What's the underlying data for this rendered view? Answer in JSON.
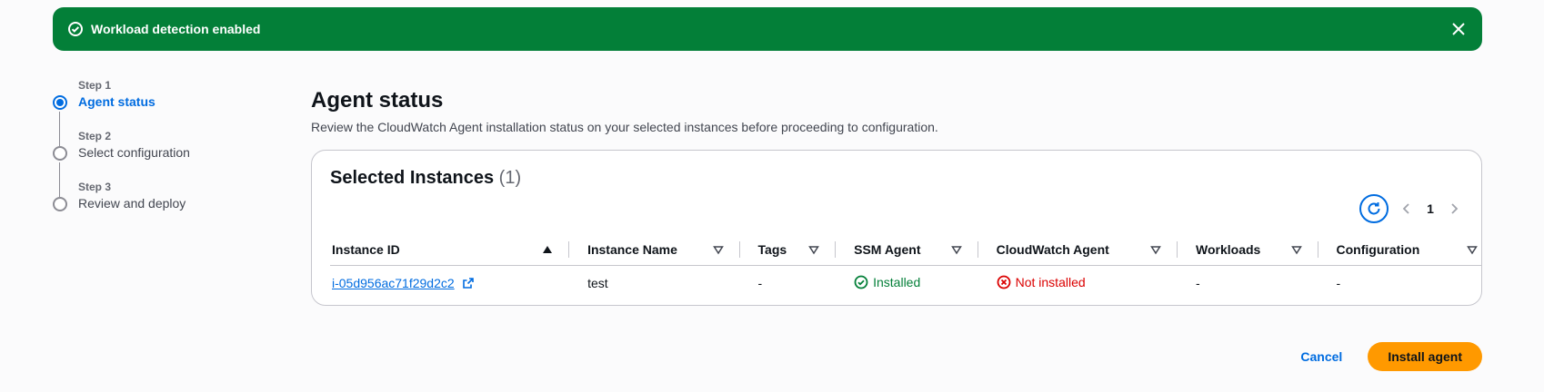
{
  "flash": {
    "message": "Workload detection enabled",
    "color": "#037f38",
    "icons": {
      "status": "check-circle-icon",
      "dismiss": "close-icon"
    }
  },
  "wizard": {
    "steps": [
      {
        "num": "Step 1",
        "label": "Agent status",
        "active": true
      },
      {
        "num": "Step 2",
        "label": "Select configuration",
        "active": false
      },
      {
        "num": "Step 3",
        "label": "Review and deploy",
        "active": false
      }
    ]
  },
  "page": {
    "title": "Agent status",
    "description": "Review the CloudWatch Agent installation status on your selected instances before proceeding to configuration."
  },
  "instances": {
    "title": "Selected Instances",
    "count": "(1)",
    "pagination": {
      "current_page": "1"
    },
    "columns": [
      "Instance ID",
      "Instance Name",
      "Tags",
      "SSM Agent",
      "CloudWatch Agent",
      "Workloads",
      "Configuration"
    ],
    "rows": [
      {
        "instance_id": "i-05d956ac71f29d2c2",
        "instance_name": "test",
        "tags": "-",
        "ssm_agent": "Installed",
        "cloudwatch_agent": "Not installed",
        "workloads": "-",
        "configuration": "-"
      }
    ]
  },
  "footer": {
    "cancel_label": "Cancel",
    "install_label": "Install agent"
  },
  "colors": {
    "accent": "#006ce0",
    "success": "#037f38",
    "error": "#db0000",
    "primary_button": "#ff9900"
  }
}
